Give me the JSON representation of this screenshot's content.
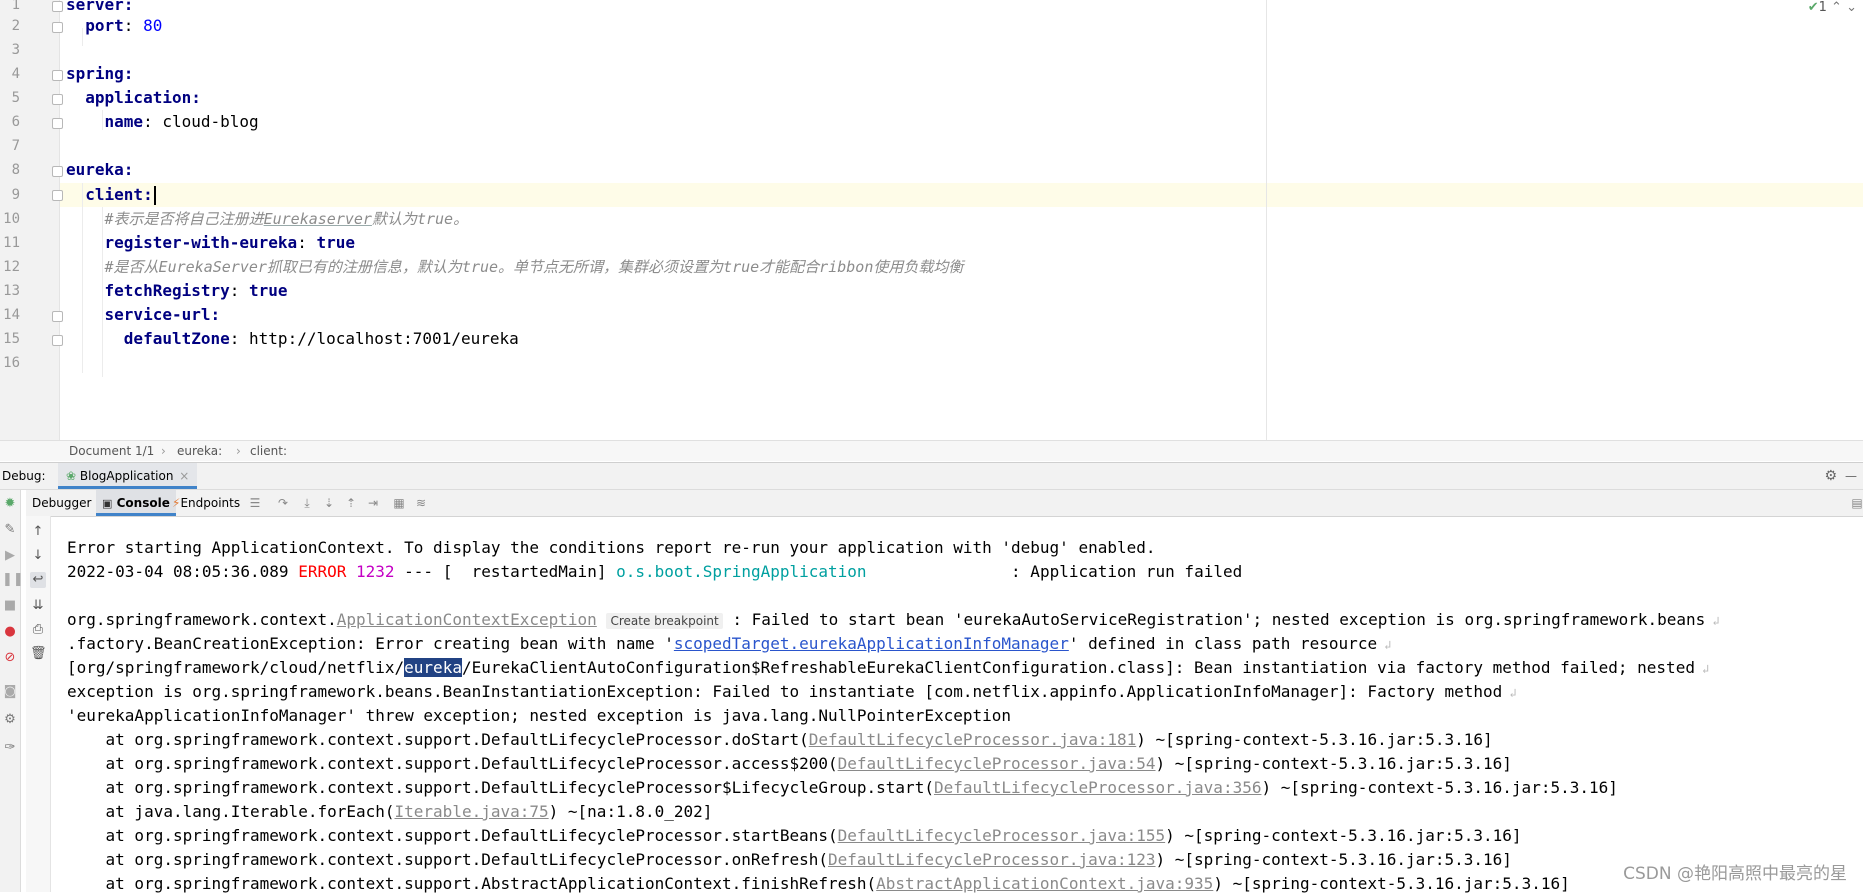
{
  "editor": {
    "inspection_count": "1",
    "lines": [
      {
        "n": "1",
        "text": "server:"
      },
      {
        "n": "2",
        "key": "port",
        "sep": ": ",
        "value": "80"
      },
      {
        "n": "3"
      },
      {
        "n": "4",
        "text": "spring:"
      },
      {
        "n": "5",
        "text": "application:"
      },
      {
        "n": "6",
        "key": "name",
        "sep": ": ",
        "value": "cloud-blog"
      },
      {
        "n": "7"
      },
      {
        "n": "8",
        "text": "eureka:"
      },
      {
        "n": "9",
        "text": "client:"
      },
      {
        "n": "10",
        "comment_pre": "#表示是否将自己注册进",
        "comment_u": "Eurekaserver",
        "comment_post": "默认为true。"
      },
      {
        "n": "11",
        "key": "register-with-eureka",
        "sep": ": ",
        "value": "true"
      },
      {
        "n": "12",
        "comment": "#是否从EurekaServer抓取已有的注册信息，默认为true。单节点无所谓，集群必须设置为true才能配合ribbon使用负载均衡"
      },
      {
        "n": "13",
        "key": "fetchRegistry",
        "sep": ": ",
        "value": "true"
      },
      {
        "n": "14",
        "text": "service-url:"
      },
      {
        "n": "15",
        "key": "defaultZone",
        "sep": ": ",
        "value": "http://localhost:7001/eureka"
      },
      {
        "n": "16"
      }
    ]
  },
  "breadcrumb": {
    "doc": "Document 1/1",
    "sep1": "›",
    "part1": "eureka:",
    "sep2": "›",
    "part2": "client:"
  },
  "debug": {
    "label": "Debug:",
    "config": "BlogApplication",
    "close": "×",
    "tabs": {
      "debugger": "Debugger",
      "console": "Console",
      "endpoints": "Endpoints"
    }
  },
  "console": {
    "l1": "Error starting ApplicationContext. To display the conditions report re-run your application with 'debug' enabled.",
    "l2_date": "2022-03-04 08:05:36.089 ",
    "l2_level": "ERROR",
    "l2_pid": " 1232",
    "l2_mid": " --- [  restartedMain] ",
    "l2_logger": "o.s.boot.SpringApplication",
    "l2_msg": "               : Application run failed",
    "l3_a": "org.springframework.context.",
    "l3_link": "ApplicationContextException",
    "l3_bp": "Create breakpoint",
    "l3_b": " : Failed to start bean 'eurekaAutoServiceRegistration'; nested exception is org.springframework.beans",
    "l4_a": ".factory.BeanCreationException: Error creating bean with name '",
    "l4_link": "scopedTarget.eurekaApplicationInfoManager",
    "l4_b": "' defined in class path resource",
    "l5_a": "[org/springframework/cloud/netflix/",
    "l5_sel": "eureka",
    "l5_b": "/EurekaClientAutoConfiguration$RefreshableEurekaClientConfiguration.class]: Bean instantiation via factory method failed; nested",
    "l6": "exception is org.springframework.beans.BeanInstantiationException: Failed to instantiate [com.netflix.appinfo.ApplicationInfoManager]: Factory method",
    "l7": "'eurekaApplicationInfoManager' threw exception; nested exception is java.lang.NullPointerException",
    "stack": [
      {
        "pre": "    at org.springframework.context.support.DefaultLifecycleProcessor.doStart(",
        "src": "DefaultLifecycleProcessor.java:181",
        "post": ") ~[spring-context-5.3.16.jar:5.3.16]"
      },
      {
        "pre": "    at org.springframework.context.support.DefaultLifecycleProcessor.access$200(",
        "src": "DefaultLifecycleProcessor.java:54",
        "post": ") ~[spring-context-5.3.16.jar:5.3.16]"
      },
      {
        "pre": "    at org.springframework.context.support.DefaultLifecycleProcessor$LifecycleGroup.start(",
        "src": "DefaultLifecycleProcessor.java:356",
        "post": ") ~[spring-context-5.3.16.jar:5.3.16]"
      },
      {
        "pre": "    at java.lang.Iterable.forEach(",
        "src": "Iterable.java:75",
        "post": ") ~[na:1.8.0_202]"
      },
      {
        "pre": "    at org.springframework.context.support.DefaultLifecycleProcessor.startBeans(",
        "src": "DefaultLifecycleProcessor.java:155",
        "post": ") ~[spring-context-5.3.16.jar:5.3.16]"
      },
      {
        "pre": "    at org.springframework.context.support.DefaultLifecycleProcessor.onRefresh(",
        "src": "DefaultLifecycleProcessor.java:123",
        "post": ") ~[spring-context-5.3.16.jar:5.3.16]"
      },
      {
        "pre": "    at org.springframework.context.support.AbstractApplicationContext.finishRefresh(",
        "src": "AbstractApplicationContext.java:935",
        "post": ") ~[spring-context-5.3.16.jar:5.3.16]"
      }
    ]
  },
  "watermark": "CSDN @艳阳高照中最亮的星"
}
